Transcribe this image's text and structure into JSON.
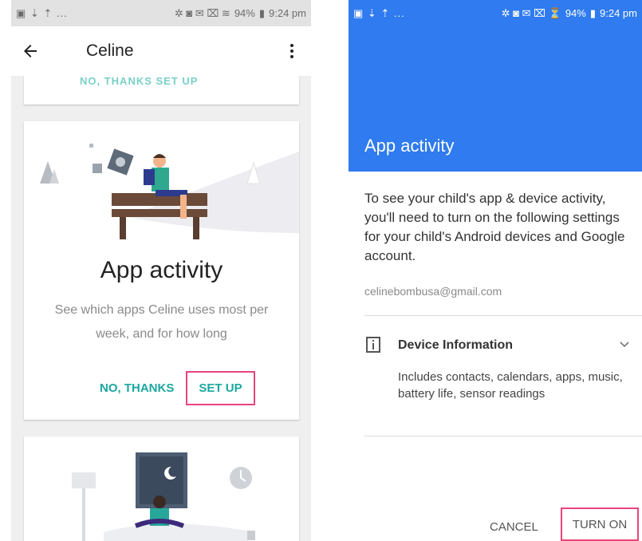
{
  "left": {
    "status": {
      "left_icons": "▣ ⇣ ⇡ ...",
      "right_icons": "✲ ◙ ✉ ⌧ ≋",
      "battery": "94%",
      "time": "9:24 pm"
    },
    "app_bar": {
      "title": "Celine"
    },
    "card_top": {
      "faded_text": "NO, THANKS     SET UP"
    },
    "card_main": {
      "heading": "App activity",
      "description": "See which apps Celine uses most per week, and for how long",
      "no_thanks": "NO, THANKS",
      "set_up": "SET UP"
    }
  },
  "right": {
    "status": {
      "left_icons": "▣ ⇣ ⇡ ...",
      "right_icons": "✲ ◙ ✉ ⌧ ⏳",
      "battery": "94%",
      "time": "9:24 pm"
    },
    "header_title": "App activity",
    "body_text": "To see your child's app & device activity, you'll need to turn on the following settings for your child's Android devices and Google account.",
    "email": "celinebombusa@gmail.com",
    "device": {
      "title": "Device Information",
      "description": "Includes contacts, calendars, apps, music, battery life, sensor readings"
    },
    "cancel": "CANCEL",
    "turn_on": "TURN ON"
  },
  "colors": {
    "accent_blue": "#2f7bef",
    "teal": "#1ba7a0",
    "highlight": "#e8457a"
  }
}
